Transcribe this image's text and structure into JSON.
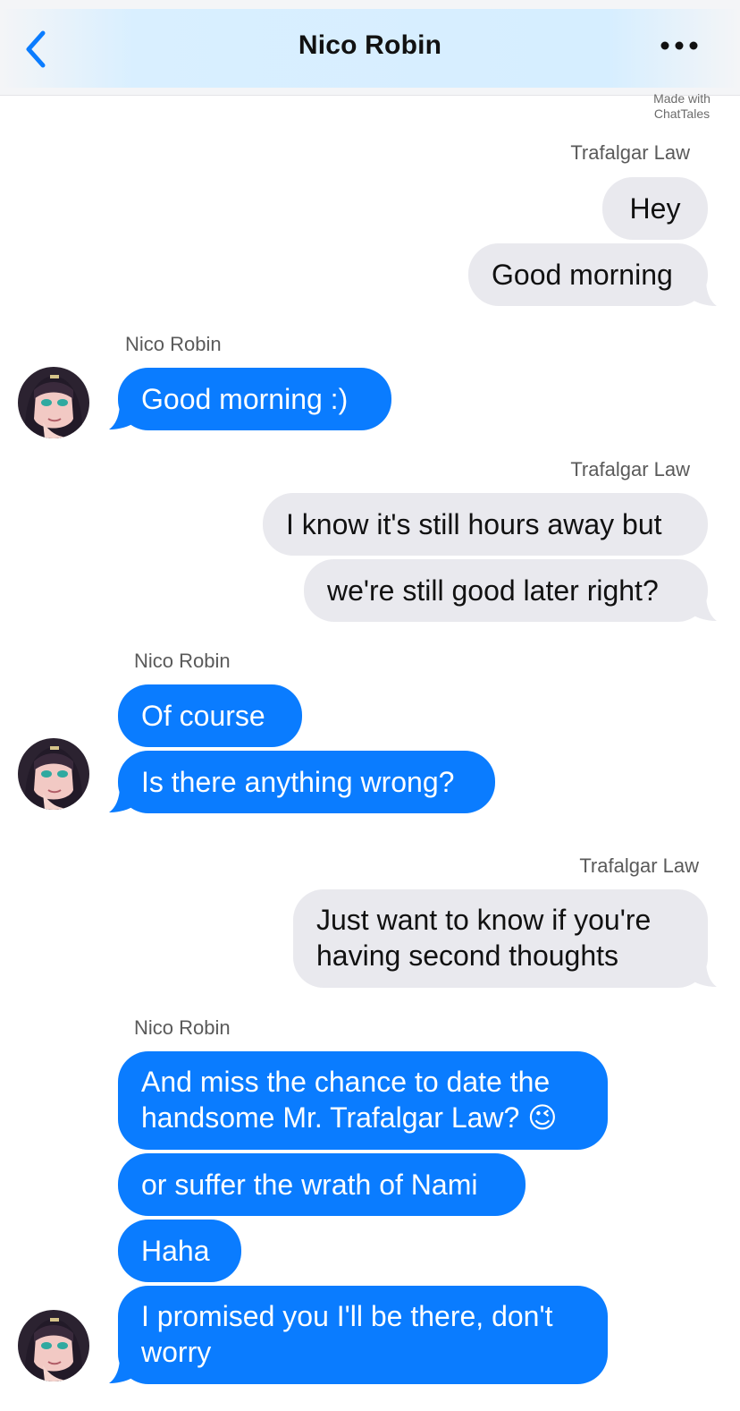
{
  "header": {
    "title": "Nico Robin"
  },
  "watermark": {
    "line1": "Made with",
    "line2": "ChatTales"
  },
  "icons": {
    "back": "chevron-left-icon",
    "more": "ellipsis-icon",
    "emoji": "winking-face"
  },
  "colors": {
    "accent": "#0a7cff",
    "outgoing_bubble": "#e9e9ee",
    "header_glow": "#d6eeff"
  },
  "messages": [
    {
      "sender": "Trafalgar Law",
      "direction": "outgoing",
      "texts": [
        "Hey",
        "Good morning"
      ]
    },
    {
      "sender": "Nico Robin",
      "direction": "incoming",
      "texts": [
        "Good morning :)"
      ]
    },
    {
      "sender": "Trafalgar Law",
      "direction": "outgoing",
      "texts": [
        "I know it's still hours away but",
        "we're still good later right?"
      ]
    },
    {
      "sender": "Nico Robin",
      "direction": "incoming",
      "texts": [
        "Of course",
        "Is there anything wrong?"
      ]
    },
    {
      "sender": "Trafalgar Law",
      "direction": "outgoing",
      "texts": [
        "Just want to know if you're having second thoughts"
      ]
    },
    {
      "sender": "Nico Robin",
      "direction": "incoming",
      "texts": [
        "And miss the chance to date the handsome Mr. Trafalgar Law? 😉",
        "or suffer the wrath of Nami",
        "Haha",
        "I promised you I'll be there, don't worry"
      ]
    }
  ]
}
